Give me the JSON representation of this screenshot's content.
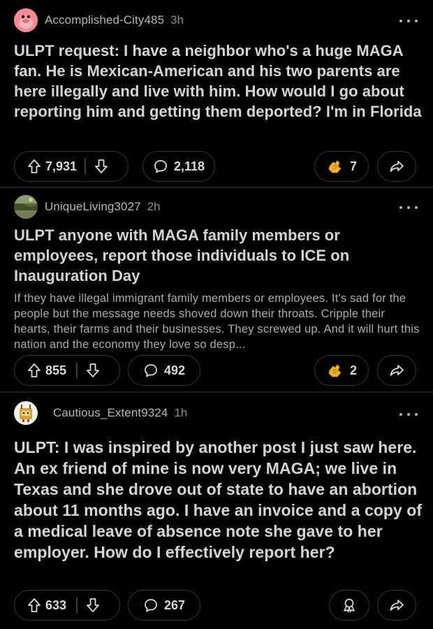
{
  "posts": [
    {
      "username": "Accomplished-City485",
      "time": "3h",
      "title": "ULPT request: I have a neighbor who's a huge MAGA fan. He is Mexican-American and his two parents are here illegally and live with him. How would I go about reporting him and getting them deported? I'm in Florida",
      "body": "",
      "upvotes": "7,931",
      "comments": "2,118",
      "awards": "7",
      "avatar_color": "#f28b96"
    },
    {
      "username": "UniqueLiving3027",
      "time": "2h",
      "title": "ULPT anyone with MAGA family members or employees, report those individuals to ICE on Inauguration Day",
      "body": "If they have illegal immigrant family members or employees. It's sad for the people but the message needs shoved down their throats. Cripple their hearts, their farms and their businesses. They screwed up. And it will hurt this nation and the economy they love so desp...",
      "upvotes": "855",
      "comments": "492",
      "awards": "2",
      "avatar_color": "#6f7d4a"
    },
    {
      "username": "Cautious_Extent9324",
      "time": "1h",
      "title": "ULPT: I was inspired by another post I just saw here. An ex friend of mine is now very MAGA; we live in Texas and she drove out of state to have an abortion about 11 months ago. I have an invoice and a copy of a medical leave of absence note she gave to her employer. How do I effectively report her?",
      "body": "",
      "upvotes": "633",
      "comments": "267",
      "awards": "",
      "avatar_color": "#e8c84a"
    }
  ],
  "colors": {
    "background": "#000000",
    "pill_border": "#343638",
    "award_gold": "#f2b51d"
  },
  "icons": [
    "upvote-icon",
    "downvote-icon",
    "comment-icon",
    "award-icon",
    "share-icon",
    "more-options-icon"
  ]
}
